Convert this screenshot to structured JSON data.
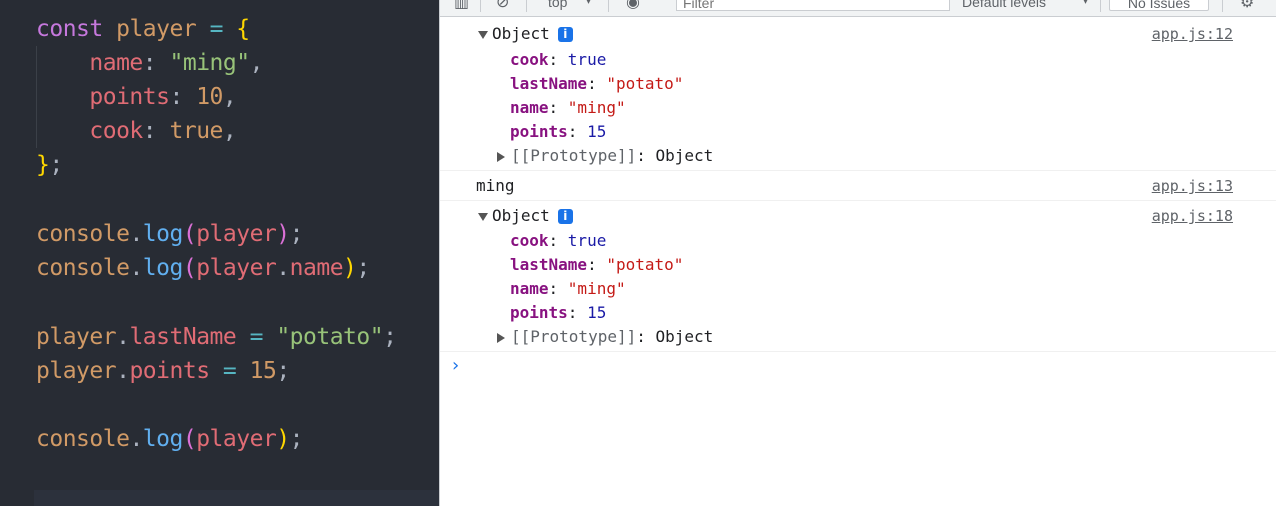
{
  "editor": {
    "line1": {
      "kw": "const",
      "var": "player",
      "op": "=",
      "brace": "{"
    },
    "line2": {
      "prop": "name",
      "colon": ":",
      "str": "\"ming\"",
      "comma": ","
    },
    "line3": {
      "prop": "points",
      "colon": ":",
      "num": "10",
      "comma": ","
    },
    "line4": {
      "prop": "cook",
      "colon": ":",
      "val": "true",
      "comma": ","
    },
    "line5": {
      "brace": "}",
      "semi": ";"
    },
    "line6": {
      "obj": "console",
      "dot": ".",
      "fn": "log",
      "open": "(",
      "arg": "player",
      "close": ")",
      "semi": ";"
    },
    "line7": {
      "obj": "console",
      "dot": ".",
      "fn": "log",
      "open": "(",
      "arg": "player",
      "dot2": ".",
      "prop": "name",
      "close": ")",
      "semi": ";"
    },
    "line8": {
      "obj": "player",
      "dot": ".",
      "prop": "lastName",
      "op": "=",
      "str": "\"potato\"",
      "semi": ";"
    },
    "line9": {
      "obj": "player",
      "dot": ".",
      "prop": "points",
      "op": "=",
      "num": "15",
      "semi": ";"
    },
    "line10": {
      "obj": "console",
      "dot": ".",
      "fn": "log",
      "open": "(",
      "arg": "player",
      "close": ")",
      "semi": ";"
    }
  },
  "toolbar": {
    "context": "top",
    "filter_placeholder": "Filter",
    "levels": "Default levels",
    "issues": "No Issues"
  },
  "console": {
    "messages": [
      {
        "type": "object",
        "label": "Object",
        "source": "app.js:12",
        "props": [
          {
            "key": "cook",
            "value": "true"
          },
          {
            "key": "lastName",
            "value": "\"potato\""
          },
          {
            "key": "name",
            "value": "\"ming\""
          },
          {
            "key": "points",
            "value": "15"
          }
        ],
        "proto_key": "[[Prototype]]",
        "proto_value": "Object"
      },
      {
        "type": "text",
        "text": "ming",
        "source": "app.js:13"
      },
      {
        "type": "object",
        "label": "Object",
        "source": "app.js:18",
        "props": [
          {
            "key": "cook",
            "value": "true"
          },
          {
            "key": "lastName",
            "value": "\"potato\""
          },
          {
            "key": "name",
            "value": "\"ming\""
          },
          {
            "key": "points",
            "value": "15"
          }
        ],
        "proto_key": "[[Prototype]]",
        "proto_value": "Object"
      }
    ],
    "prompt": "›"
  },
  "icons": {
    "info": "i",
    "expanded": "triangle-down-icon",
    "collapsed": "triangle-right-icon"
  },
  "colors": {
    "editor_bg": "#282c34",
    "keyword": "#c678dd",
    "string": "#98c379",
    "property": "#e06c75",
    "function": "#61afef",
    "console_key": "#881280",
    "console_string": "#c41a16",
    "console_number": "#1a1aa6",
    "accent": "#1a73e8"
  }
}
